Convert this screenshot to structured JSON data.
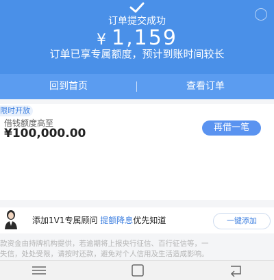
{
  "hero": {
    "title": "订单提交成功",
    "currency": "¥",
    "amount": "1,159",
    "note": "订单已享专属额度，预计到账时间较长"
  },
  "actions": {
    "home_label": "回到首页",
    "view_order_label": "查看订单"
  },
  "card": {
    "tag": "限时开放",
    "limit_label": "借钱额度高至",
    "limit_value": "¥100,000.00",
    "borrow_button": "再借一笔"
  },
  "advisor": {
    "prefix": "添加1V1专属顾问 ",
    "highlight": "提额降息",
    "suffix": "优先知道",
    "add_button": "一键添加"
  },
  "disclaimer": {
    "line1": "款资金由持牌机构提供，若逾期将上报央行征信、百行征信等，一",
    "line2": "失信，处处受限，请按时还款，避免对个人信用及生活造成影响。"
  },
  "colors": {
    "primary": "#4a90e8",
    "accent": "#3d7fe0"
  },
  "icons": {
    "check": "check-icon",
    "corner": "help-icon",
    "nav_menu": "menu-icon",
    "nav_home": "home-icon",
    "nav_back": "back-icon"
  }
}
